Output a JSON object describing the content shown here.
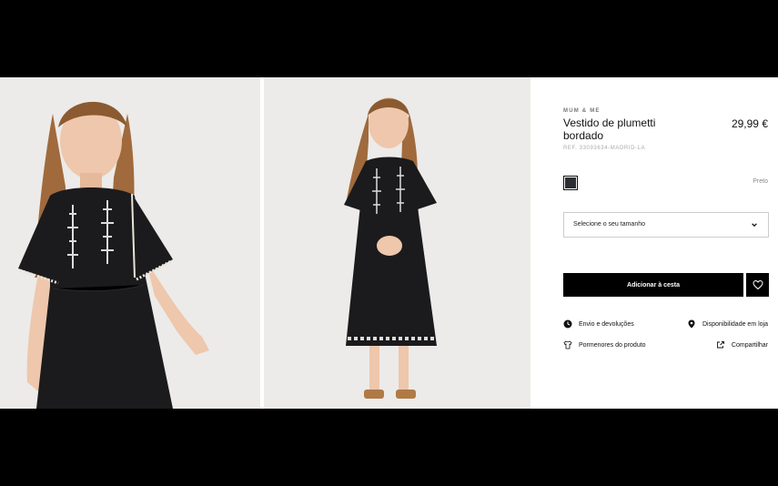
{
  "product": {
    "brand": "MUM & ME",
    "title": "Vestido de plumetti bordado",
    "price": "29,99 €",
    "reference": "REF. 33093634-MADRID-LA"
  },
  "color": {
    "name": "Preto",
    "swatch_hex": "#2b2e33"
  },
  "size_select": {
    "label": "Selecione o seu tamanho",
    "icon": "chevron-down-icon"
  },
  "actions": {
    "add_to_cart": "Adicionar à cesta",
    "favorite_icon": "heart-icon"
  },
  "links": {
    "shipping": {
      "label": "Envio e devoluções",
      "icon": "clock-icon"
    },
    "store_availability": {
      "label": "Disponibilidade em loja",
      "icon": "location-pin-icon"
    },
    "product_details": {
      "label": "Pormenores do produto",
      "icon": "tshirt-icon"
    },
    "share": {
      "label": "Compartilhar",
      "icon": "share-icon"
    }
  },
  "colors": {
    "background_photo": "#ecebe9",
    "dress": "#1b1b1d",
    "button": "#000000"
  }
}
